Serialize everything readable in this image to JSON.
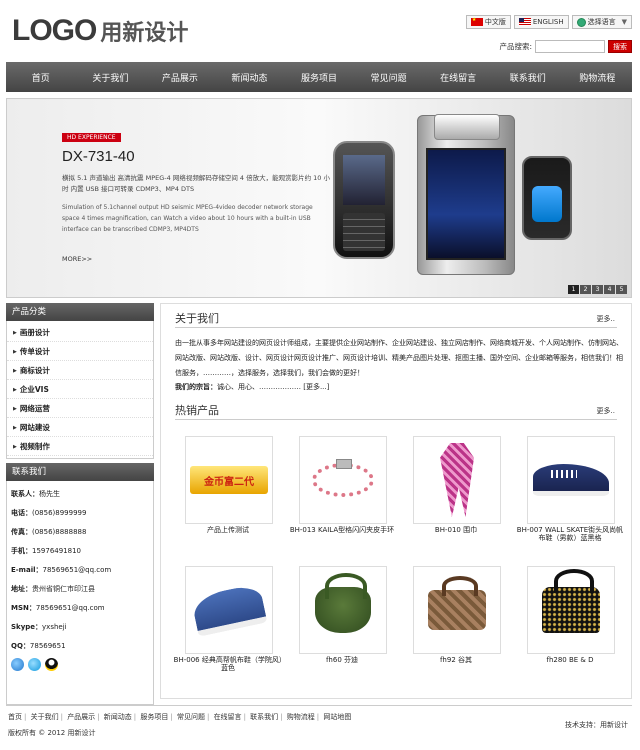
{
  "header": {
    "logo_en": "LOGO",
    "logo_cn": "用新设计",
    "lang": [
      "中文版",
      "ENGLISH",
      "选择语言"
    ],
    "search_label": "产品搜索:",
    "search_value": "",
    "search_button": "搜索"
  },
  "nav": [
    "首页",
    "关于我们",
    "产品展示",
    "新闻动态",
    "服务项目",
    "常见问题",
    "在线留言",
    "联系我们",
    "购物流程"
  ],
  "banner": {
    "badge": "HD EXPERIENCE",
    "model": "DX-731-40",
    "desc_cn": "横拟 5.1 声道输出 高清抗震 MPEG-4 网络视频解码存储空间 4 倍放大，能观赏影片约 10 小时 内置 USB 接口可转录 CDMP3、MP4 DTS",
    "desc_en": "Simulation of 5.1channel output HD seismic MPEG-4video decoder network storage space 4 times magnification, can Watch a video about 10 hours with a built-in USB interface can be transcribed CDMP3, MP4DTS",
    "more": "MORE>>",
    "pages": [
      "1",
      "2",
      "3",
      "4",
      "5"
    ]
  },
  "sidebar": {
    "category_title": "产品分类",
    "categories": [
      "画册设计",
      "传单设计",
      "商标设计",
      "企业VIS",
      "网络运营",
      "网站建设",
      "视频制作"
    ],
    "contact_title": "联系我们",
    "contacts": [
      {
        "label": "联系人：",
        "value": "杨先生"
      },
      {
        "label": "电话：",
        "value": "(0856)8999999"
      },
      {
        "label": "传真：",
        "value": "(0856)8888888"
      },
      {
        "label": "手机：",
        "value": "15976491810"
      },
      {
        "label": "E-mail：",
        "value": "78569651@qq.com"
      },
      {
        "label": "地址：",
        "value": "贵州省铜仁市印江县"
      },
      {
        "label": "MSN：",
        "value": "78569651@qq.com"
      },
      {
        "label": "Skype：",
        "value": "yxsheji"
      },
      {
        "label": "QQ：",
        "value": "78569651"
      }
    ]
  },
  "about": {
    "title": "关于我们",
    "more": "更多..",
    "text": "由一批从事多年网站建设的网页设计师组成，主要提供企业网站制作、企业网站建设、独立网店制作、网络商城开发、个人网站制作、仿制网站、网站改版、网站改版、设计、网页设计网页设计推广、网页设计培训、精美产品图片处理、抠图主播、国外空间、企业邮箱等服务，相信我们！相信服务，…………，选择服务，选择我们，我们会做的更好！",
    "principle_label": "我们的宗旨：",
    "principle_text": "诚心、用心、……………… [更多...]"
  },
  "hot": {
    "title": "热销产品",
    "more": "更多..",
    "products": [
      {
        "name": "产品上传测试",
        "img": "logo-image"
      },
      {
        "name": "BH-013 KAILA型格闪闪夹皮手环",
        "img": "bracelet-image"
      },
      {
        "name": "BH-010 围巾",
        "img": "scarf-image"
      },
      {
        "name": "BH-007 WALL SKATE街头风尚帆布鞋（男款）蓝黑格",
        "img": "shoe-image"
      },
      {
        "name": "BH-006 经典高帮帆布鞋（学院风）蓝色",
        "img": "sneaker-image"
      },
      {
        "name": "fh60 芬迪",
        "img": "green-bag-image"
      },
      {
        "name": "fh92 谷其",
        "img": "brown-bag-image"
      },
      {
        "name": "fh280 BE & D",
        "img": "black-bag-image"
      }
    ]
  },
  "footer": {
    "links": [
      "首页",
      "关于我们",
      "产品展示",
      "新闻动态",
      "服务项目",
      "常见问题",
      "在线留言",
      "联系我们",
      "购物流程",
      "网站地图"
    ],
    "copyright": "版权所有 © 2012 用新设计",
    "support": "技术支持：用新设计"
  }
}
